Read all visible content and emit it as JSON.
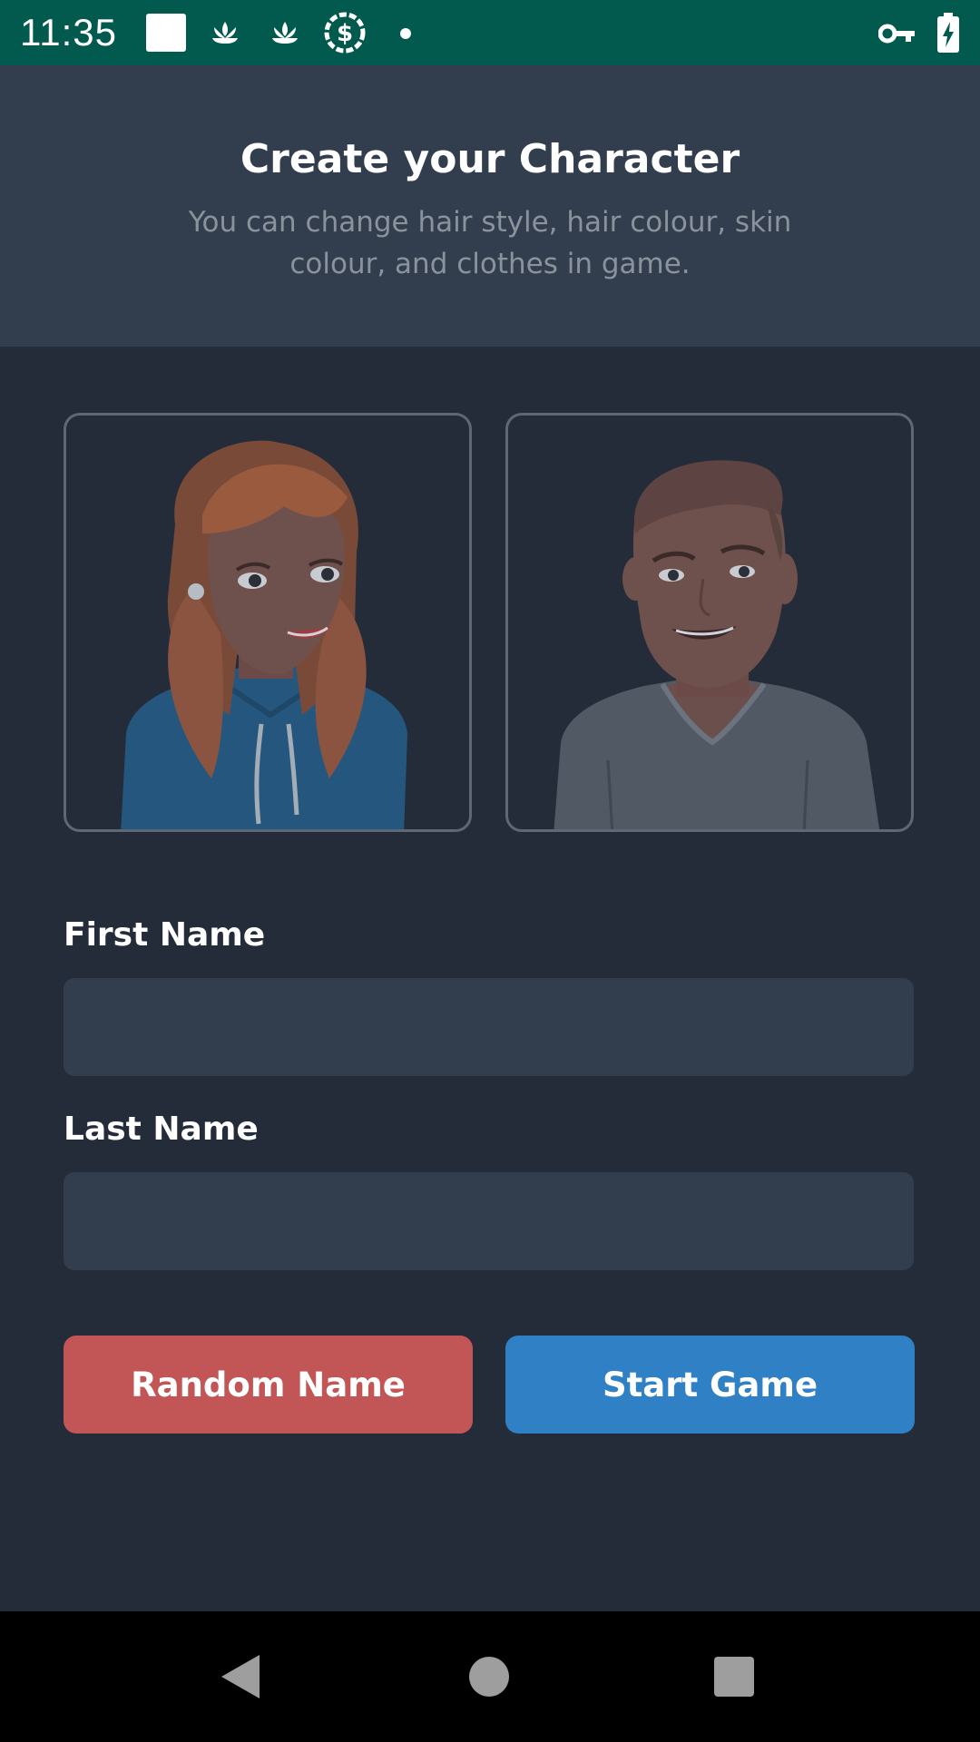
{
  "status_bar": {
    "time": "11:35",
    "icons": [
      "square-notification-icon",
      "lotus-icon",
      "lotus-icon",
      "dollar-circle-icon",
      "dot-icon",
      "vpn-key-icon",
      "battery-charging-icon"
    ],
    "background": "#02594d"
  },
  "header": {
    "title": "Create your Character",
    "subtitle": "You can change hair style, hair colour, skin colour, and clothes in game."
  },
  "characters": [
    {
      "name": "female-character",
      "hair": "#9a5a3e",
      "top": "#25577e"
    },
    {
      "name": "male-character",
      "hair": "#5d4443",
      "top": "#505964"
    }
  ],
  "form": {
    "first_name_label": "First Name",
    "first_name_value": "",
    "last_name_label": "Last Name",
    "last_name_value": ""
  },
  "buttons": {
    "random_name": "Random Name",
    "start_game": "Start Game"
  },
  "colors": {
    "background": "#242c3a",
    "panel": "#323e4e",
    "random_button": "#c25656",
    "start_button": "#2f80c4"
  },
  "nav_bar": {
    "icons": [
      "back-icon",
      "home-icon",
      "recents-icon"
    ]
  }
}
